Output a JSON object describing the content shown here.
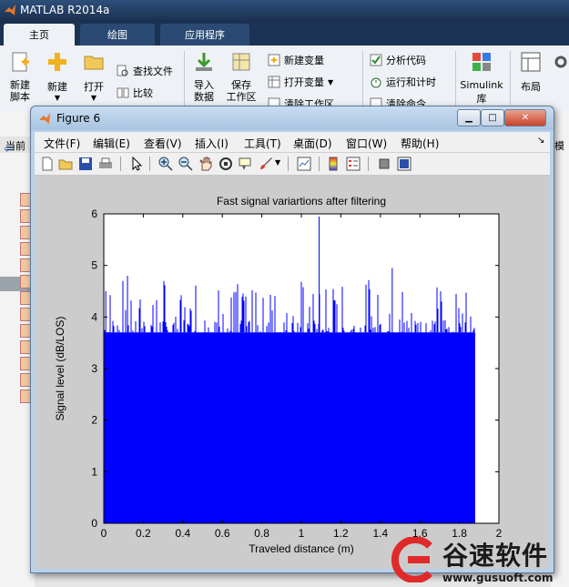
{
  "app": {
    "title": "MATLAB R2014a"
  },
  "ribbon_tabs": [
    {
      "label": "主页",
      "active": true
    },
    {
      "label": "绘图",
      "active": false
    },
    {
      "label": "应用程序",
      "active": false
    }
  ],
  "ribbon": {
    "new_script": "新建\n脚本",
    "new": "新建",
    "open": "打开",
    "find_files": "查找文件",
    "compare": "比较",
    "import_data": "导入\n数据",
    "save_workspace": "保存\n工作区",
    "new_variable": "新建变量",
    "open_variable": "打开变量",
    "clear_workspace": "清除工作区",
    "analyze_code": "分析代码",
    "run_and_time": "运行和计时",
    "clear_commands": "清除命令",
    "simulink": "Simulink",
    "simulink_sub": "库",
    "layout": "布局"
  },
  "left_pane": {
    "current_folder": "当前"
  },
  "right_pane": {
    "label": "模"
  },
  "figure": {
    "title": "Figure 6",
    "menus": [
      "文件(F)",
      "编辑(E)",
      "查看(V)",
      "插入(I)",
      "工具(T)",
      "桌面(D)",
      "窗口(W)",
      "帮助(H)"
    ],
    "toolbar_icons": [
      "new-figure-icon",
      "open-file-icon",
      "save-icon",
      "print-icon",
      "pointer-icon",
      "zoom-in-icon",
      "zoom-out-icon",
      "pan-hand-icon",
      "rotate-3d-icon",
      "data-cursor-icon",
      "brush-icon",
      "link-plot-icon",
      "colorbar-icon",
      "legend-icon",
      "hide-plot-tools-icon",
      "show-plot-tools-icon"
    ]
  },
  "chart_data": {
    "type": "bar",
    "title": "Fast signal variartions after filtering",
    "xlabel": "Traveled distance (m)",
    "ylabel": "Signal level (dB/LOS)",
    "xlim": [
      0,
      2
    ],
    "ylim": [
      0,
      6
    ],
    "xticks": [
      "0",
      "0.2",
      "0.4",
      "0.6",
      "0.8",
      "1",
      "1.2",
      "1.4",
      "1.6",
      "1.8",
      "2"
    ],
    "yticks": [
      "0",
      "1",
      "2",
      "3",
      "4",
      "5",
      "6"
    ],
    "grid": false,
    "color": "#0000ff",
    "x_range_of_data": [
      0,
      1.88
    ],
    "baseline_level": 3.7,
    "typical_peak_range": [
      4.0,
      4.8
    ],
    "notable_peaks": [
      {
        "x": 1.09,
        "y": 5.95
      },
      {
        "x": 0.12,
        "y": 4.8
      },
      {
        "x": 1.46,
        "y": 4.95
      },
      {
        "x": 0.01,
        "y": 4.5
      }
    ]
  },
  "watermark": {
    "text": "谷速软件",
    "url": "www.gusuoft.com"
  },
  "colors": {
    "series": "#0000ff",
    "figure_bg": "#cccccc",
    "titlebar": "#1b3352"
  }
}
